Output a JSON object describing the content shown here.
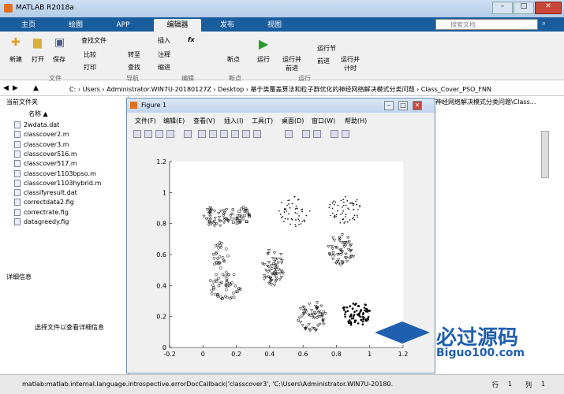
{
  "app": {
    "title": "MATLAB R2018a"
  },
  "tabs": [
    "主页",
    "绘图",
    "APP",
    "编辑器",
    "发布",
    "视图"
  ],
  "search": {
    "placeholder": "搜索文档"
  },
  "ribbon": {
    "new": "新建",
    "open": "打开",
    "save": "保存",
    "find_files": "查找文件",
    "compare": "比较",
    "print": "打印",
    "insert": "插入",
    "fx": "fx",
    "goto": "转至",
    "comment": "注释",
    "find": "查找",
    "indent": "缩进",
    "breakpoint": "断点",
    "run": "运行",
    "run_advance": "运行并\n前进",
    "run_section": "运行节",
    "advance": "前进",
    "run_time": "运行并\n计时",
    "groups": [
      "文件",
      "导航",
      "编辑",
      "断点",
      "运行"
    ]
  },
  "address": {
    "path": "C: › Users › Administrator.WIN7U-20180127Z › Desktop › 基于类覆盖算法和粒子群优化的神经网络解决模式分类问题 › Class_Cover_PSO_FNN"
  },
  "current_folder": {
    "title": "当前文件夹",
    "column": "名称 ▲",
    "files": [
      "2wdata.dat",
      "classcover2.m",
      "classcover3.m",
      "classcover516.m",
      "classcover517.m",
      "classcover1103bpso.m",
      "classcover1103hybrid.m",
      "classifyresult.dat",
      "correctdata2.fig",
      "correctrate.fig",
      "datagreedy.fig"
    ],
    "details_title": "详细信息",
    "details_msg": "选择文件以查看详细信息"
  },
  "right_path": "神经网络解决模式分类问题\\Class...",
  "figure": {
    "title": "Figure 1",
    "menus": [
      "文件(F)",
      "编辑(E)",
      "查看(V)",
      "插入(I)",
      "工具(T)",
      "桌面(D)",
      "窗口(W)",
      "帮助(H)"
    ]
  },
  "chart_data": {
    "type": "scatter",
    "xlim": [
      -0.2,
      1.2
    ],
    "ylim": [
      0,
      1.2
    ],
    "xticks": [
      "-0.2",
      "0",
      "0.2",
      "0.4",
      "0.6",
      "0.8",
      "1",
      "1.2"
    ],
    "yticks": [
      "0",
      "0.2",
      "0.4",
      "0.6",
      "0.8",
      "1",
      "1.2"
    ],
    "clusters": [
      {
        "name": "",
        "cx": 0.08,
        "cy": 0.85,
        "rx": 0.09,
        "ry": 0.07,
        "n": 45,
        "marker": "tri"
      },
      {
        "name": "",
        "cx": 0.22,
        "cy": 0.85,
        "rx": 0.06,
        "ry": 0.06,
        "n": 30,
        "marker": "sq"
      },
      {
        "name": "",
        "cx": 0.1,
        "cy": 0.6,
        "rx": 0.05,
        "ry": 0.09,
        "n": 25,
        "marker": "o"
      },
      {
        "name": "",
        "cx": 0.13,
        "cy": 0.4,
        "rx": 0.1,
        "ry": 0.09,
        "n": 50,
        "marker": "o"
      },
      {
        "name": "",
        "cx": 0.42,
        "cy": 0.52,
        "rx": 0.07,
        "ry": 0.12,
        "n": 60,
        "marker": "tri"
      },
      {
        "name": "",
        "cx": 0.55,
        "cy": 0.88,
        "rx": 0.1,
        "ry": 0.1,
        "n": 50,
        "marker": "dot"
      },
      {
        "name": "",
        "cx": 0.85,
        "cy": 0.9,
        "rx": 0.1,
        "ry": 0.1,
        "n": 60,
        "marker": "dot"
      },
      {
        "name": "",
        "cx": 0.83,
        "cy": 0.63,
        "rx": 0.08,
        "ry": 0.1,
        "n": 55,
        "marker": "tri"
      },
      {
        "name": "",
        "cx": 0.65,
        "cy": 0.2,
        "rx": 0.09,
        "ry": 0.1,
        "n": 60,
        "marker": "tri"
      },
      {
        "name": "",
        "cx": 0.92,
        "cy": 0.22,
        "rx": 0.09,
        "ry": 0.08,
        "n": 70,
        "marker": "fill"
      }
    ]
  },
  "statusbar": {
    "text": "matlab:matlab.internal.language.introspective.errorDocCallback('classcover3', 'C:\\Users\\Administrator.WIN7U-20180...",
    "row_label": "行",
    "row": "1",
    "col_label": "列",
    "col": "1"
  },
  "watermark": {
    "text": "必过源码",
    "url": "Biguo100.com"
  }
}
